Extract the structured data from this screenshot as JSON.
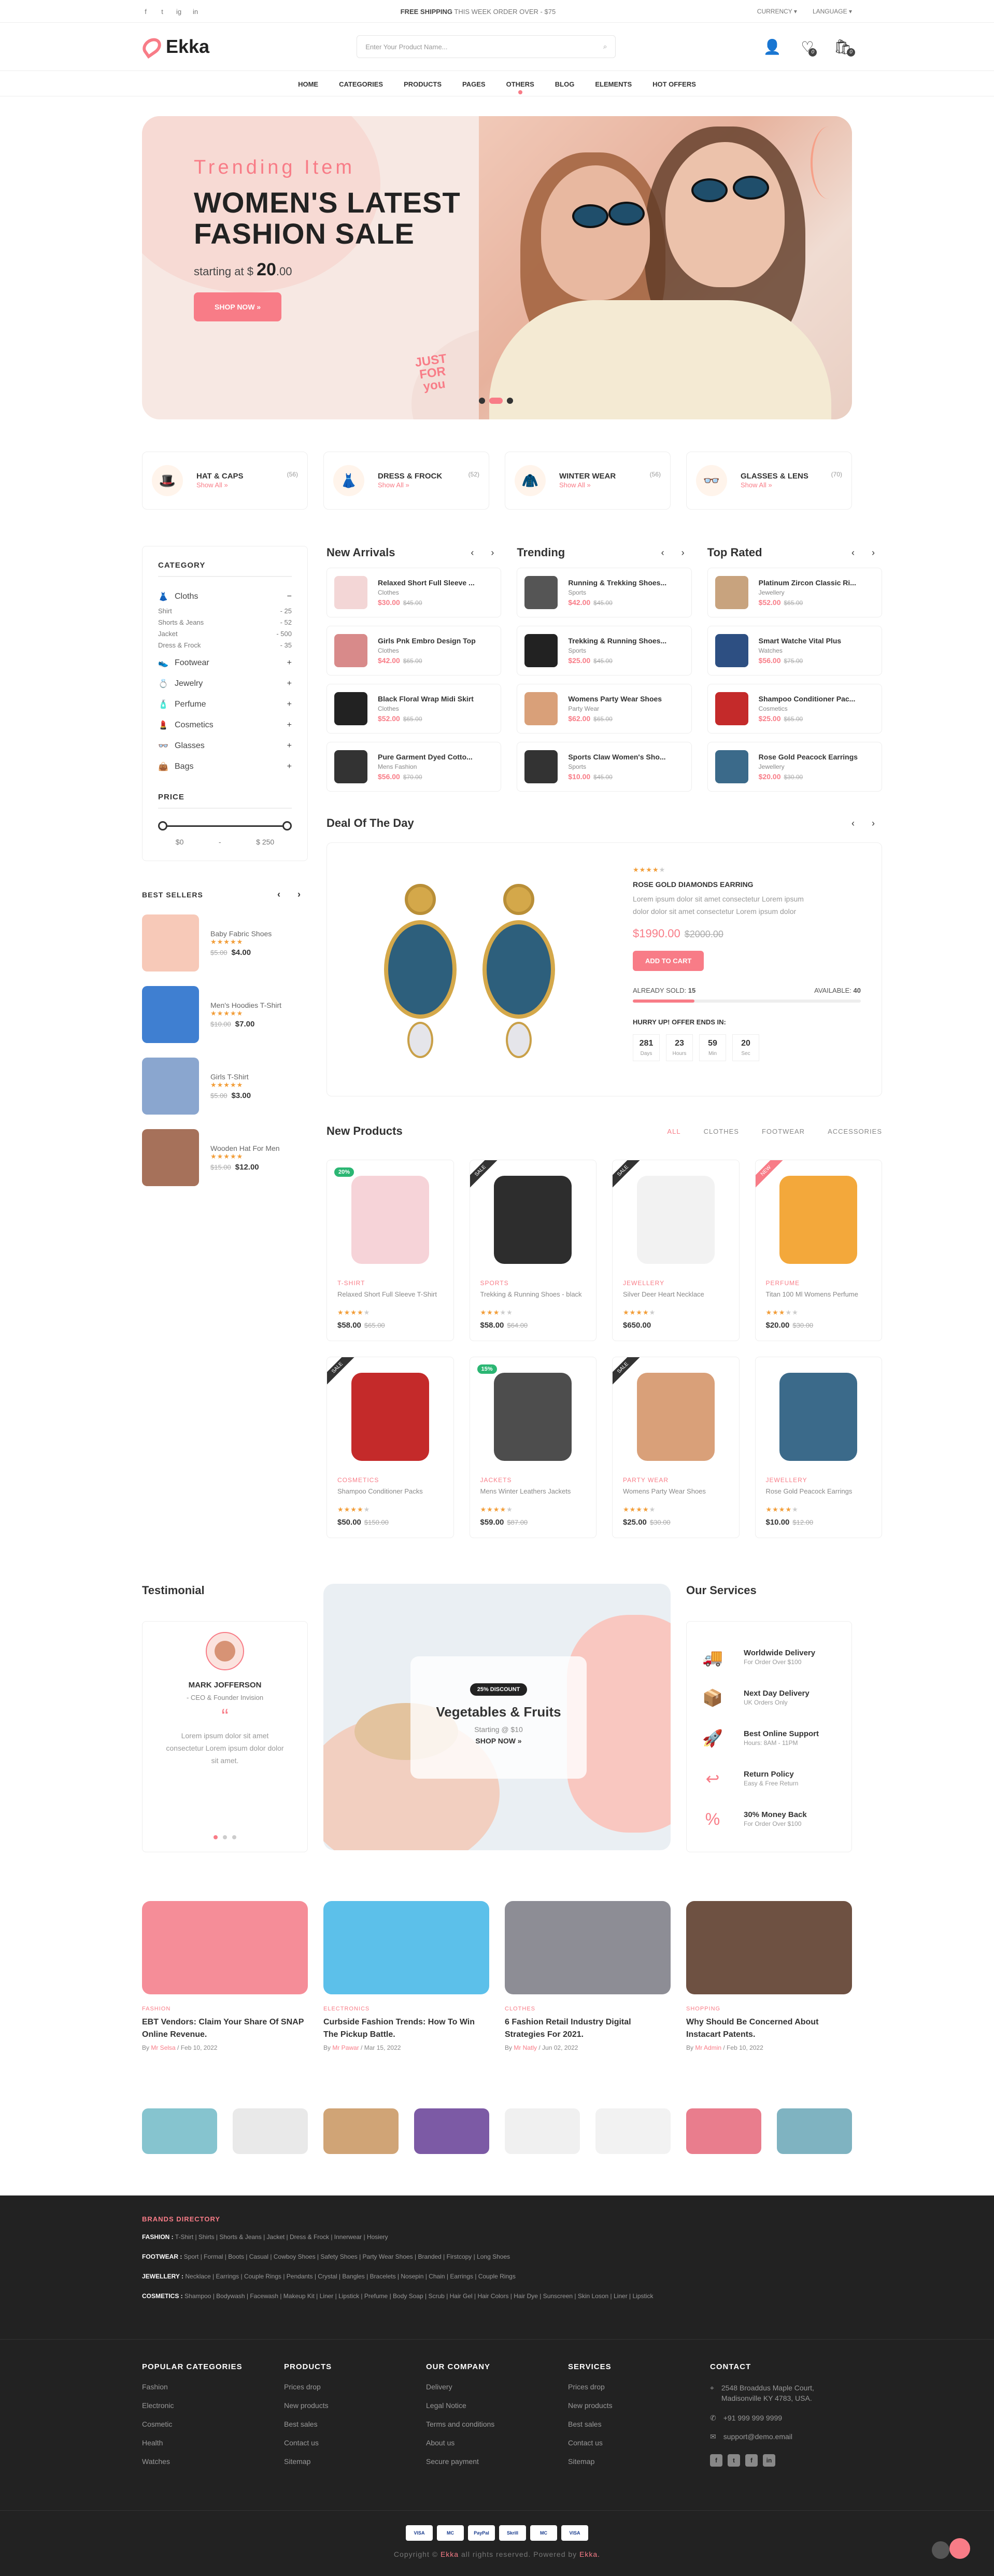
{
  "topbar": {
    "shipping_bold": "FREE SHIPPING",
    "shipping_rest": " THIS WEEK ORDER OVER - $75",
    "currency": "CURRENCY ▾",
    "language": "LANGUAGE ▾",
    "social": [
      "f",
      "t",
      "ig",
      "in"
    ]
  },
  "header": {
    "logo": "Ekka",
    "search_placeholder": "Enter Your Product Name...",
    "wishlist_count": "0",
    "cart_count": "0"
  },
  "nav": [
    "HOME",
    "CATEGORIES",
    "PRODUCTS",
    "PAGES",
    "OTHERS",
    "BLOG",
    "ELEMENTS",
    "HOT OFFERS"
  ],
  "hero": {
    "sub": "Trending Item",
    "title_line1": "WOMEN'S LATEST",
    "title_line2": "FASHION SALE",
    "starting": "starting at $ ",
    "price": "20",
    "cents": ".00",
    "button": "SHOP NOW »",
    "stamp1": "JUST",
    "stamp2": "FOR",
    "stamp3": "you"
  },
  "categories": [
    {
      "name": "HAT & CAPS",
      "link": "Show All »",
      "count": "(56)",
      "icon": "🎩"
    },
    {
      "name": "DRESS & FROCK",
      "link": "Show All »",
      "count": "(52)",
      "icon": "👗"
    },
    {
      "name": "WINTER WEAR",
      "link": "Show All »",
      "count": "(56)",
      "icon": "🧥"
    },
    {
      "name": "GLASSES & LENS",
      "link": "Show All »",
      "count": "(70)",
      "icon": "👓"
    }
  ],
  "sidebar": {
    "category_title": "CATEGORY",
    "cats": [
      {
        "label": "Cloths",
        "icon": "👗",
        "sign": "−"
      },
      {
        "label": "Footwear",
        "icon": "👟",
        "sign": "+"
      },
      {
        "label": "Jewelry",
        "icon": "💍",
        "sign": "+"
      },
      {
        "label": "Perfume",
        "icon": "🧴",
        "sign": "+"
      },
      {
        "label": "Cosmetics",
        "icon": "💄",
        "sign": "+"
      },
      {
        "label": "Glasses",
        "icon": "👓",
        "sign": "+"
      },
      {
        "label": "Bags",
        "icon": "👜",
        "sign": "+"
      }
    ],
    "subcats": [
      {
        "n": "Shirt",
        "c": "- 25"
      },
      {
        "n": "Shorts & Jeans",
        "c": "- 52"
      },
      {
        "n": "Jacket",
        "c": "- 500"
      },
      {
        "n": "Dress & Frock",
        "c": "- 35"
      }
    ],
    "price_title": "PRICE",
    "price_min": "$0",
    "price_max": "$ 250",
    "bestsellers_title": "BEST SELLERS",
    "bestsellers": [
      {
        "name": "Baby Fabric Shoes",
        "old": "$5.00",
        "price": "$4.00",
        "color": "#f7c9b8"
      },
      {
        "name": "Men's Hoodies T-Shirt",
        "old": "$10.00",
        "price": "$7.00",
        "color": "#3f7fd1"
      },
      {
        "name": "Girls T-Shirt",
        "old": "$5.00",
        "price": "$3.00",
        "color": "#8aa6cf"
      },
      {
        "name": "Wooden Hat For Men",
        "old": "$15.00",
        "price": "$12.00",
        "color": "#a6715a"
      }
    ]
  },
  "lists": [
    {
      "title": "New Arrivals",
      "items": [
        {
          "name": "Relaxed Short Full Sleeve ...",
          "cat": "Clothes",
          "price": "$30.00",
          "old": "$45.00",
          "color": "#f3d6d6"
        },
        {
          "name": "Girls Pnk Embro Design Top",
          "cat": "Clothes",
          "price": "$42.00",
          "old": "$65.00",
          "color": "#d88a8a"
        },
        {
          "name": "Black Floral Wrap Midi Skirt",
          "cat": "Clothes",
          "price": "$52.00",
          "old": "$65.00",
          "color": "#222"
        },
        {
          "name": "Pure Garment Dyed Cotto...",
          "cat": "Mens Fashion",
          "price": "$56.00",
          "old": "$70.00",
          "color": "#333"
        }
      ]
    },
    {
      "title": "Trending",
      "items": [
        {
          "name": "Running & Trekking Shoes...",
          "cat": "Sports",
          "price": "$42.00",
          "old": "$45.00",
          "color": "#555"
        },
        {
          "name": "Trekking & Running Shoes...",
          "cat": "Sports",
          "price": "$25.00",
          "old": "$45.00",
          "color": "#222"
        },
        {
          "name": "Womens Party Wear Shoes",
          "cat": "Party Wear",
          "price": "$62.00",
          "old": "$65.00",
          "color": "#d9a079"
        },
        {
          "name": "Sports Claw Women's Sho...",
          "cat": "Sports",
          "price": "$10.00",
          "old": "$45.00",
          "color": "#333"
        }
      ]
    },
    {
      "title": "Top Rated",
      "items": [
        {
          "name": "Platinum Zircon Classic Ri...",
          "cat": "Jewellery",
          "price": "$52.00",
          "old": "$65.00",
          "color": "#c8a37e"
        },
        {
          "name": "Smart Watche Vital Plus",
          "cat": "Watches",
          "price": "$56.00",
          "old": "$75.00",
          "color": "#2d4f82"
        },
        {
          "name": "Shampoo Conditioner Pac...",
          "cat": "Cosmetics",
          "price": "$25.00",
          "old": "$65.00",
          "color": "#c42a2a"
        },
        {
          "name": "Rose Gold Peacock Earrings",
          "cat": "Jewellery",
          "price": "$20.00",
          "old": "$30.00",
          "color": "#3b6a8a"
        }
      ]
    }
  ],
  "deal": {
    "title": "Deal Of The Day",
    "name": "ROSE GOLD DIAMONDS EARRING",
    "desc": "Lorem ipsum dolor sit amet consectetur Lorem ipsum dolor dolor sit amet consectetur Lorem ipsum dolor",
    "price": "$1990.00",
    "old": "$2000.00",
    "button": "ADD TO CART",
    "sold_label": "ALREADY SOLD:",
    "sold": "15",
    "avail_label": "AVAILABLE:",
    "avail": "40",
    "sold_fraction": 0.27,
    "hurry": "HURRY UP! OFFER ENDS IN:",
    "countdown": [
      {
        "v": "281",
        "l": "Days"
      },
      {
        "v": "23",
        "l": "Hours"
      },
      {
        "v": "59",
        "l": "Min"
      },
      {
        "v": "20",
        "l": "Sec"
      }
    ]
  },
  "new_products": {
    "title": "New Products",
    "tabs": [
      "ALL",
      "CLOTHES",
      "FOOTWEAR",
      "ACCESSORIES"
    ],
    "items": [
      {
        "cat": "T-SHIRT",
        "name": "Relaxed Short Full Sleeve T-Shirt",
        "price": "$58.00",
        "old": "$65.00",
        "badge": "20%",
        "ribbon": "",
        "color": "#f6d3d8",
        "stars": 4
      },
      {
        "cat": "SPORTS",
        "name": "Trekking & Running Shoes - black",
        "price": "$58.00",
        "old": "$64.00",
        "badge": "",
        "ribbon": "SALE",
        "color": "#2d2d2d",
        "stars": 3
      },
      {
        "cat": "JEWELLERY",
        "name": "Silver Deer Heart Necklace",
        "price": "$650.00",
        "old": "",
        "badge": "",
        "ribbon": "SALE",
        "color": "#f2f2f2",
        "stars": 4
      },
      {
        "cat": "PERFUME",
        "name": "Titan 100 Ml Womens Perfume",
        "price": "$20.00",
        "old": "$30.00",
        "badge": "",
        "ribbon": "NEW",
        "color": "#f3a83b",
        "stars": 3
      },
      {
        "cat": "COSMETICS",
        "name": "Shampoo Conditioner Packs",
        "price": "$50.00",
        "old": "$150.00",
        "badge": "",
        "ribbon": "SALE",
        "color": "#c42a2a",
        "stars": 4
      },
      {
        "cat": "JACKETS",
        "name": "Mens Winter Leathers Jackets",
        "price": "$59.00",
        "old": "$87.00",
        "badge": "15%",
        "ribbon": "",
        "color": "#4d4d4d",
        "stars": 4
      },
      {
        "cat": "PARTY WEAR",
        "name": "Womens Party Wear Shoes",
        "price": "$25.00",
        "old": "$30.00",
        "badge": "",
        "ribbon": "SALE",
        "color": "#d9a079",
        "stars": 4
      },
      {
        "cat": "JEWELLERY",
        "name": "Rose Gold Peacock Earrings",
        "price": "$10.00",
        "old": "$12.00",
        "badge": "",
        "ribbon": "",
        "color": "#3b6a8a",
        "stars": 4
      }
    ]
  },
  "testimonial": {
    "title": "Testimonial",
    "name": "MARK JOFFERSON",
    "role": "- CEO & Founder Invision",
    "quote": "“",
    "text": "Lorem ipsum dolor sit amet consectetur Lorem ipsum dolor dolor sit amet."
  },
  "banner": {
    "tag": "25% DISCOUNT",
    "title": "Vegetables & Fruits",
    "starting": "Starting @ $10",
    "cta": "SHOP NOW »"
  },
  "services": {
    "title": "Our Services",
    "items": [
      {
        "t": "Worldwide Delivery",
        "s": "For Order Over $100",
        "icon": "🚚"
      },
      {
        "t": "Next Day Delivery",
        "s": "UK Orders Only",
        "icon": "📦"
      },
      {
        "t": "Best Online Support",
        "s": "Hours: 8AM - 11PM",
        "icon": "🚀"
      },
      {
        "t": "Return Policy",
        "s": "Easy & Free Return",
        "icon": "↩"
      },
      {
        "t": "30% Money Back",
        "s": "For Order Over $100",
        "icon": "%"
      }
    ]
  },
  "blogs": [
    {
      "cat": "FASHION",
      "title": "EBT Vendors: Claim Your Share Of SNAP Online Revenue.",
      "by": "By",
      "author": "Mr Selsa",
      "date": "/ Feb 10, 2022",
      "color": "#f58d98"
    },
    {
      "cat": "ELECTRONICS",
      "title": "Curbside Fashion Trends: How To Win The Pickup Battle.",
      "by": "By",
      "author": "Mr Pawar",
      "date": "/ Mar 15, 2022",
      "color": "#5cc0ea"
    },
    {
      "cat": "CLOTHES",
      "title": "6 Fashion Retail Industry Digital Strategies For 2021.",
      "by": "By",
      "author": "Mr Natly",
      "date": "/ Jun 02, 2022",
      "color": "#8d8d95"
    },
    {
      "cat": "SHOPPING",
      "title": "Why Should Be Concerned About Instacart Patents.",
      "by": "By",
      "author": "Mr Admin",
      "date": "/ Feb 10, 2022",
      "color": "#6e5142"
    }
  ],
  "insta_colors": [
    "#86c4cf",
    "#e9e9e9",
    "#d0a476",
    "#7c5aa5",
    "#f0f0f0",
    "#f2f2f2",
    "#e97d8d",
    "#7fb3c1"
  ],
  "footer": {
    "brands_title": "BRANDS DIRECTORY",
    "brands": [
      {
        "k": "FASHION :",
        "v": "T-Shirt | Shirts | Shorts & Jeans | Jacket | Dress & Frock | Innerwear | Hosiery"
      },
      {
        "k": "FOOTWEAR :",
        "v": "Sport | Formal | Boots | Casual | Cowboy Shoes | Safety Shoes | Party Wear Shoes | Branded | Firstcopy | Long Shoes"
      },
      {
        "k": "JEWELLERY :",
        "v": "Necklace | Earrings | Couple Rings | Pendants | Crystal | Bangles | Bracelets | Nosepin | Chain | Earrings | Couple Rings"
      },
      {
        "k": "COSMETICS :",
        "v": "Shampoo | Bodywash | Facewash | Makeup Kit | Liner | Lipstick | Prefume | Body Soap | Scrub | Hair Gel | Hair Colors | Hair Dye | Sunscreen | Skin Loson | Liner | Lipstick"
      }
    ],
    "cols": [
      {
        "h": "POPULAR CATEGORIES",
        "items": [
          "Fashion",
          "Electronic",
          "Cosmetic",
          "Health",
          "Watches"
        ]
      },
      {
        "h": "PRODUCTS",
        "items": [
          "Prices drop",
          "New products",
          "Best sales",
          "Contact us",
          "Sitemap"
        ]
      },
      {
        "h": "OUR COMPANY",
        "items": [
          "Delivery",
          "Legal Notice",
          "Terms and conditions",
          "About us",
          "Secure payment"
        ]
      },
      {
        "h": "SERVICES",
        "items": [
          "Prices drop",
          "New products",
          "Best sales",
          "Contact us",
          "Sitemap"
        ]
      }
    ],
    "contact_title": "CONTACT",
    "address": "2548 Broaddus Maple Court, Madisonville KY 4783, USA.",
    "phone": "+91 999 999 9999",
    "email": "support@demo.email",
    "social": [
      "f",
      "t",
      "f",
      "in"
    ],
    "payments": [
      "VISA",
      "MC",
      "PayPal",
      "Skrill",
      "MC",
      "VISA"
    ],
    "copyright": "Copyright © ",
    "copy_brand": "Ekka",
    "copy_rest": " all rights reserved. Powered by ",
    "copy_brand2": "Ekka."
  }
}
